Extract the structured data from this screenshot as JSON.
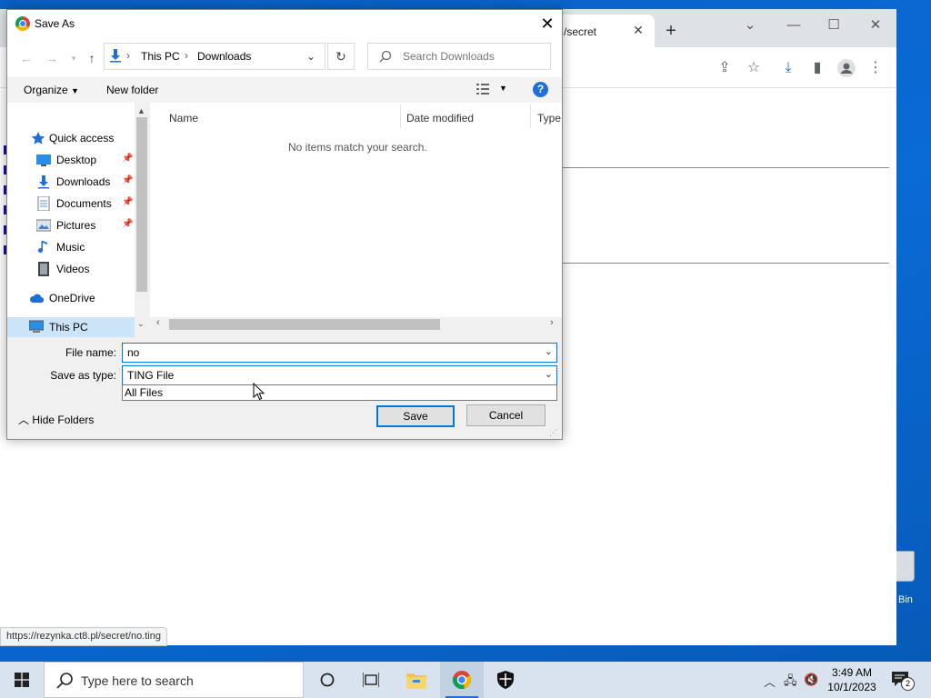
{
  "browser": {
    "tab_title": "/secret",
    "status_url": "https://rezynka.ct8.pl/secret/no.ting"
  },
  "desktop": {
    "recycle_bin_label": "Bin"
  },
  "dialog": {
    "title": "Save As",
    "breadcrumb": [
      "This PC",
      "Downloads"
    ],
    "search_placeholder": "Search Downloads",
    "organize_label": "Organize",
    "new_folder_label": "New folder",
    "nav_items": [
      {
        "label": "Quick access",
        "icon": "star-icon"
      },
      {
        "label": "Desktop",
        "icon": "desktop-icon",
        "pinned": true
      },
      {
        "label": "Downloads",
        "icon": "download-icon",
        "pinned": true
      },
      {
        "label": "Documents",
        "icon": "document-icon",
        "pinned": true
      },
      {
        "label": "Pictures",
        "icon": "pictures-icon",
        "pinned": true
      },
      {
        "label": "Music",
        "icon": "music-icon"
      },
      {
        "label": "Videos",
        "icon": "video-icon"
      },
      {
        "label": "OneDrive",
        "icon": "cloud-icon"
      },
      {
        "label": "This PC",
        "icon": "computer-icon",
        "selected": true
      }
    ],
    "columns": [
      "Name",
      "Date modified",
      "Type"
    ],
    "empty_message": "No items match your search.",
    "file_name_label": "File name:",
    "file_name_value": "no",
    "save_type_label": "Save as type:",
    "save_type_value": "TING File",
    "save_type_options": [
      "All Files"
    ],
    "hide_folders_label": "Hide Folders",
    "save_label": "Save",
    "cancel_label": "Cancel"
  },
  "taskbar": {
    "search_placeholder": "Type here to search",
    "time": "3:49 AM",
    "date": "10/1/2023",
    "notification_count": "2"
  },
  "colors": {
    "accent": "#0078d7",
    "desktop": "#0a63c7",
    "selection": "#cce4f7"
  }
}
